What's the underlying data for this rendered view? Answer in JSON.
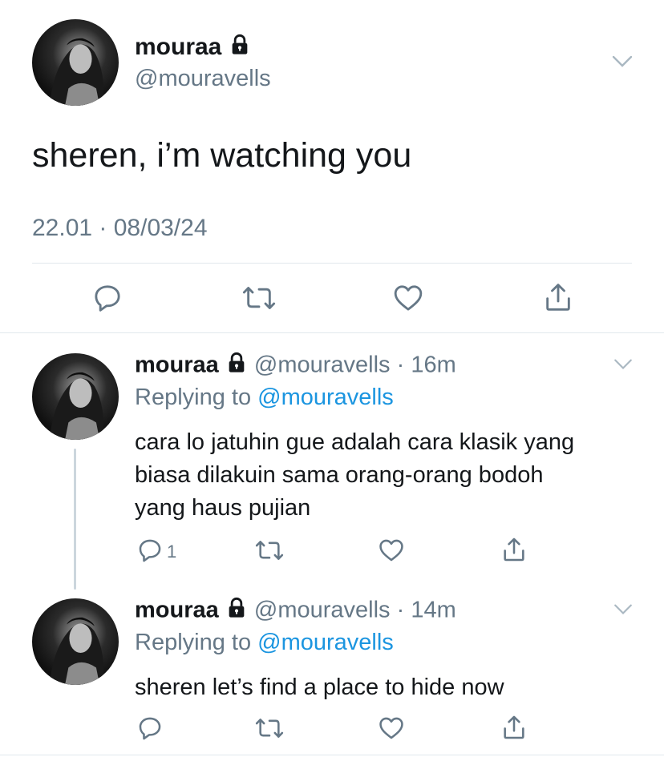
{
  "main_tweet": {
    "display_name": "mouraa",
    "handle": "@mouravells",
    "text": "sheren, i’m watching you",
    "timestamp": "22.01 · 08/03/24",
    "icons": [
      "reply-icon",
      "retweet-icon",
      "like-icon",
      "share-icon"
    ]
  },
  "replies": [
    {
      "display_name": "mouraa",
      "handle": "@mouravells",
      "time": "· 16m",
      "replying_prefix": "Replying to",
      "replying_handle": "@mouravells",
      "text_lines": [
        "cara lo jatuhin gue adalah cara klasik yang",
        "biasa dilakuin sama orang-orang bodoh",
        "yang haus pujian"
      ],
      "reply_count": "1"
    },
    {
      "display_name": "mouraa",
      "handle": "@mouravells",
      "time": "· 14m",
      "replying_prefix": "Replying to",
      "replying_handle": "@mouravells",
      "text_lines": [
        "sheren let’s find a place to hide now"
      ],
      "reply_count": ""
    }
  ],
  "colors": {
    "text": "#14171a",
    "secondary": "#657786",
    "link": "#1b95e0",
    "divider": "#e1e8ed",
    "thread_line": "#ccd6dd"
  }
}
